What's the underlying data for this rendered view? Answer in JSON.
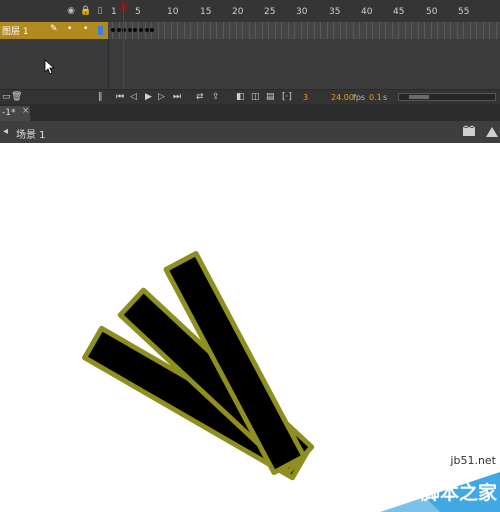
{
  "timeline": {
    "ruler_ticks": [
      "1",
      "5",
      "10",
      "15",
      "20",
      "25",
      "30",
      "35",
      "40",
      "45",
      "50",
      "55"
    ],
    "header_icons": [
      "eye-icon",
      "lock-icon",
      "outline-icon"
    ],
    "layer": {
      "name": "图层 1",
      "color": "#b08a1f",
      "icons": [
        "pencil-icon",
        "dot-icon",
        "dot-icon",
        "color-swatch-icon"
      ]
    },
    "keyframe_count": 8,
    "playhead_frame": 5
  },
  "controls": {
    "current_frame": "3",
    "fps_value": "24.00",
    "fps_unit": "fps",
    "time_value": "0.1",
    "time_unit": "s"
  },
  "document": {
    "tab_label": "-1*",
    "tab_close": "×"
  },
  "scene": {
    "label": "场景 1"
  },
  "stage": {
    "shape_fill": "#000000",
    "shape_stroke": "#8f8f1f"
  },
  "watermark": {
    "site": "jb51.net",
    "text": "脚本之家"
  }
}
